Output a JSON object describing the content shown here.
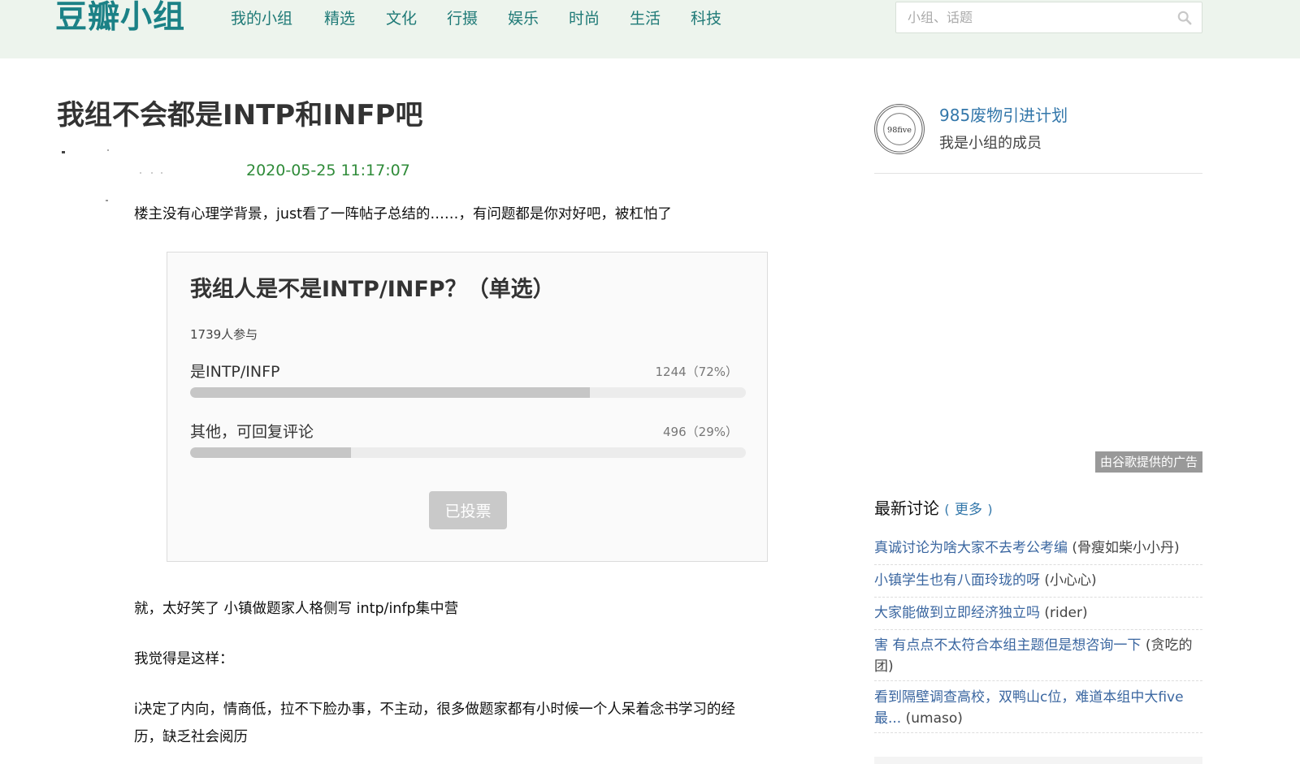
{
  "header": {
    "logo": "豆瓣小组",
    "nav": [
      "我的小组",
      "精选",
      "文化",
      "行摄",
      "娱乐",
      "时尚",
      "生活",
      "科技"
    ],
    "search": {
      "placeholder": "小组、话题",
      "value": ""
    }
  },
  "topic": {
    "title": "我组不会都是INTP和INFP吧",
    "time": "2020-05-25 11:17:07",
    "intro": "楼主没有心理学背景，just看了一阵帖子总结的……，有问题都是你对好吧，被杠怕了",
    "paragraphs": [
      "就，太好笑了 小镇做题家人格侧写 intp/infp集中营",
      "我觉得是这样：",
      "i决定了内向，情商低，拉不下脸办事，不主动，很多做题家都有小时候一个人呆着念书学习的经",
      "历，缺乏社会阅历"
    ]
  },
  "poll": {
    "title": "我组人是不是INTP/INFP？（单选）",
    "participants": "1739人参与",
    "options": [
      {
        "label": "是INTP/INFP",
        "result": "1244（72%）",
        "percent": 72
      },
      {
        "label": "其他，可回复评论",
        "result": "496（29%）",
        "percent": 29
      }
    ],
    "button": "已投票"
  },
  "sidebar": {
    "group_name": "985废物引进计划",
    "membership": "我是小组的成员",
    "group_logo_text": "98five",
    "ad_label": "由谷歌提供的广告",
    "latest": {
      "title": "最新讨论",
      "open": "(",
      "more": "更多",
      "close": ")",
      "items": [
        {
          "title": "真诚讨论为啥大家不去考公考编",
          "author": "(骨瘦如柴小小丹)"
        },
        {
          "title": "小镇学生也有八面玲珑的呀",
          "author": "(小心心)"
        },
        {
          "title": "大家能做到立即经济独立吗",
          "author": "(rider)"
        },
        {
          "title": "害 有点点不太符合本组主题但是想咨询一下",
          "author": "(贪吃的团)"
        },
        {
          "title": "看到隔壁调查高校，双鸭山c位，难道本组中大five最...",
          "author": "(umaso)"
        }
      ]
    }
  }
}
